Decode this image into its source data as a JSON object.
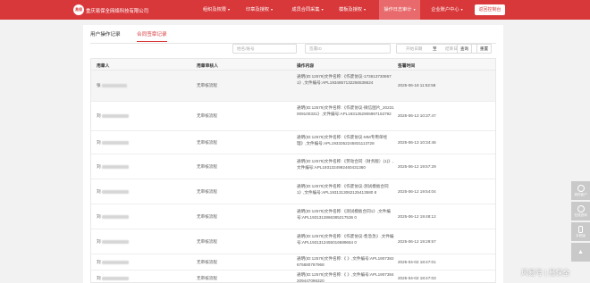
{
  "header": {
    "logo_text": "易保",
    "company": "重庆易保全网络科技有限公司",
    "nav": [
      {
        "label": "组织及权限",
        "active": false
      },
      {
        "label": "印章及授权",
        "active": false
      },
      {
        "label": "成员合同采集",
        "active": false
      },
      {
        "label": "模板及授权",
        "active": false
      },
      {
        "label": "操作日志审计",
        "active": true
      },
      {
        "label": "企业账户中心",
        "active": false
      }
    ],
    "back_button": "返回控制台"
  },
  "tabs": [
    {
      "label": "用户操作记录",
      "active": false
    },
    {
      "label": "合同签章记录",
      "active": true
    }
  ],
  "filters": {
    "user_placeholder": "姓名/账号",
    "doc_placeholder": "签署ID",
    "date_start_placeholder": "开始日期",
    "date_separator": "至",
    "date_end_placeholder": "结束日期",
    "search_label": "查询",
    "reset_label": "重置"
  },
  "table": {
    "columns": [
      "用章人",
      "用章审核人",
      "操作内容",
      "签署时间"
    ],
    "rows": [
      {
        "operator": "张",
        "approver": "无审核流程",
        "content": "通明(ID:12579)文件名称:《作废协议-1736137308671》,文件编号:APL1934857132256538624",
        "time": "2025-06-18 11:52:58"
      },
      {
        "operator": "刘",
        "approver": "无审核流程",
        "content": "通明(ID:12579)文件名称:《作废协议-微信图片_20231009100331》,文件编号:APL1931352906997153792",
        "time": "2025-06-13 10:37:47"
      },
      {
        "operator": "刘",
        "approver": "无审核流程",
        "content": "通明(ID:12579)文件名称:《作废协议-MM专用单经理》,文件编号:APL1933352245831113728",
        "time": "2025-06-13 10:34:46"
      },
      {
        "operator": "刘",
        "approver": "无审核流程",
        "content": "通明(ID:12579)文件名称:《劳动合同（财务版）(1)》,文件编号:APL1931324992460431360",
        "time": "2025-06-12 19:57:29"
      },
      {
        "operator": "刘",
        "approver": "无审核流程",
        "content": "通明(ID:12579)文件名称:《作废协议-测试模板合同1》,文件编号:APL1931313062125413580 8",
        "time": "2025-06-12 19:54:04"
      },
      {
        "operator": "刘",
        "approver": "无审核流程",
        "content": "通明(ID:12579)文件名称:《测试模板合同1》,文件编号:APL1931312866385217536 0",
        "time": "2025-06-12 19:48:12"
      },
      {
        "operator": "刘",
        "approver": "无审核流程",
        "content": "通明(ID:12579)文件名称:《作废协议-售急急》,文件编号:APL1931312455016689664 0",
        "time": "2025-06-12 19:29:57"
      },
      {
        "operator": "刘",
        "approver": "无审核流程",
        "content": "通明(ID:12579)文件名称:《 》,文件编号:APL1907382675880787968",
        "time": "2025-04-02 18:47:01"
      },
      {
        "operator": "刘",
        "approver": "无审核流程",
        "content": "通明(ID:12579)文件名称:《 》,文件编号:APL1907384209447096320",
        "time": "2025-04-02 18:47:03"
      }
    ]
  },
  "float_tools": [
    {
      "icon": "user-icon",
      "label": "我的客户"
    },
    {
      "icon": "chat-icon",
      "label": "在线咨询"
    },
    {
      "icon": "phone-icon",
      "label": "手机版"
    },
    {
      "icon": "arrow-up-icon",
      "label": ""
    }
  ],
  "watermark": "风易号 | 易保全",
  "colors": {
    "brand": "#d8383a",
    "nav_active": "#e86a6c"
  }
}
